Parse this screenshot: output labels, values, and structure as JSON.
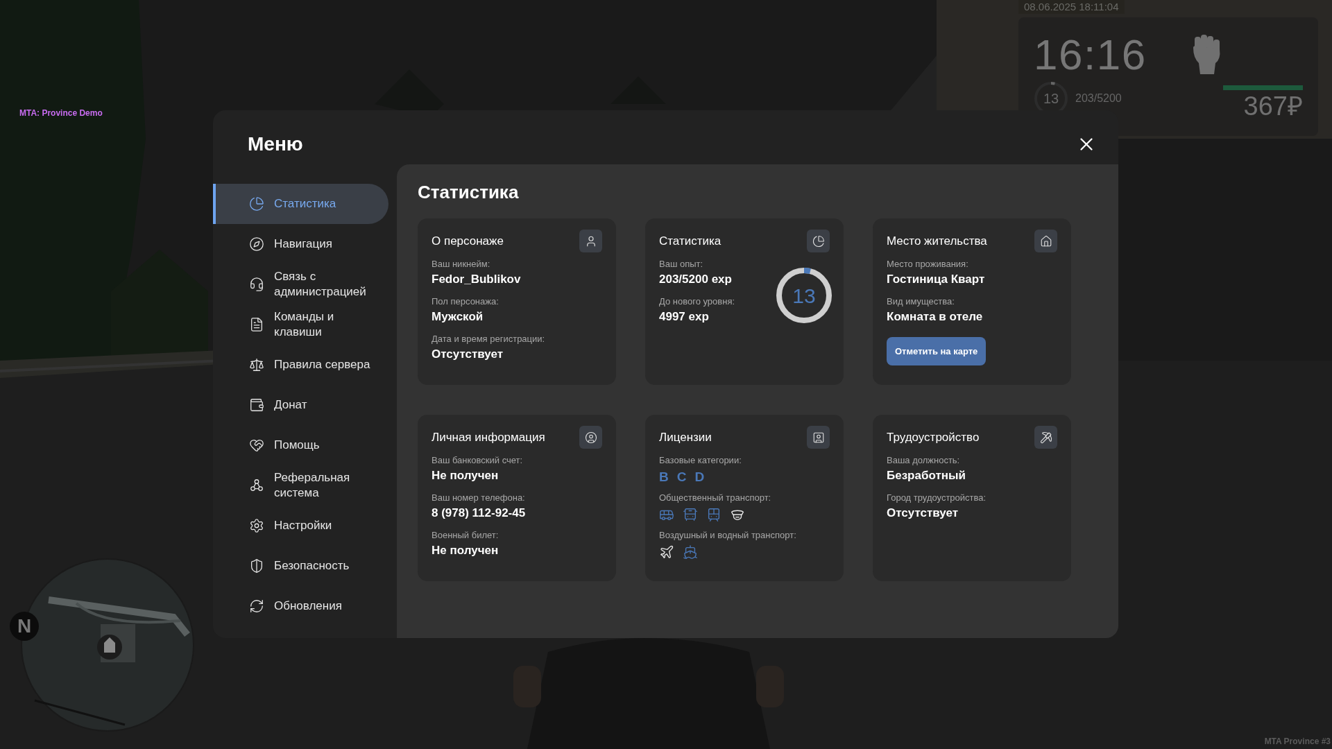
{
  "hud": {
    "server_label": "MTA: Province Demo",
    "datetime": "08.06.2025 18:11:04",
    "clock": "16:16",
    "level_ring": {
      "value": "13",
      "level": 0.04
    },
    "xp": "203/5200",
    "bar": {
      "level": 1
    },
    "money": "367₽",
    "footer": "MTA Province #3",
    "compass": "N"
  },
  "menu": {
    "title": "Меню",
    "sidebar": {
      "items": [
        {
          "label": "Статистика",
          "selected": true
        },
        {
          "label": "Навигация",
          "selected": false
        },
        {
          "label": "Связь с администрацией",
          "selected": false
        },
        {
          "label": "Команды и клавиши",
          "selected": false
        },
        {
          "label": "Правила сервера",
          "selected": false
        },
        {
          "label": "Донат",
          "selected": false
        },
        {
          "label": "Помощь",
          "selected": false
        },
        {
          "label": "Реферальная система",
          "selected": false
        },
        {
          "label": "Настройки",
          "selected": false
        },
        {
          "label": "Безопасность",
          "selected": false
        },
        {
          "label": "Обновления",
          "selected": false
        }
      ]
    },
    "section_title": "Статистика",
    "cards": [
      {
        "title": "О персонаже",
        "fields": [
          {
            "label": "Ваш никнейм:",
            "value": "Fedor_Bublikov"
          },
          {
            "label": "Пол персонажа:",
            "value": "Мужской"
          },
          {
            "label": "Дата и время регистрации:",
            "value": "Отсутствует"
          }
        ]
      },
      {
        "title": "Статистика",
        "fields": [
          {
            "label": "Ваш опыт:",
            "value": "203/5200 exp"
          },
          {
            "label": "До нового уровня:",
            "value": "4997 exp"
          }
        ],
        "ring": {
          "value": "13",
          "level": 0.04
        }
      },
      {
        "title": "Место жительства",
        "fields": [
          {
            "label": "Место проживания:",
            "value": "Гостиница Кварт"
          },
          {
            "label": "Вид имущества:",
            "value": "Комната в отеле"
          }
        ],
        "button": "Отметить на карте"
      },
      {
        "title": "Личная информация",
        "fields": [
          {
            "label": "Ваш банковский счет:",
            "value": "Не получен"
          },
          {
            "label": "Ваш номер телефона:",
            "value": "8 (978) 112-92-45"
          },
          {
            "label": "Военный билет:",
            "value": "Не получен"
          }
        ]
      },
      {
        "title": "Лицензии",
        "groups": [
          {
            "label": "Базовые категории:",
            "kind": "letters",
            "items": [
              {
                "text": "B",
                "active": true
              },
              {
                "text": "C",
                "active": true
              },
              {
                "text": "D",
                "active": true
              }
            ]
          },
          {
            "label": "Общественный транспорт:",
            "kind": "icons",
            "items": [
              {
                "active": true
              },
              {
                "active": true
              },
              {
                "active": true
              },
              {
                "active": false
              }
            ]
          },
          {
            "label": "Воздушный и водный транспорт:",
            "kind": "icons",
            "items": [
              {
                "active": false
              },
              {
                "active": true
              }
            ]
          }
        ]
      },
      {
        "title": "Трудоустройство",
        "fields": [
          {
            "label": "Ваша должность:",
            "value": "Безработный"
          },
          {
            "label": "Город трудоустройства:",
            "value": "Отсутствует"
          }
        ]
      }
    ]
  }
}
